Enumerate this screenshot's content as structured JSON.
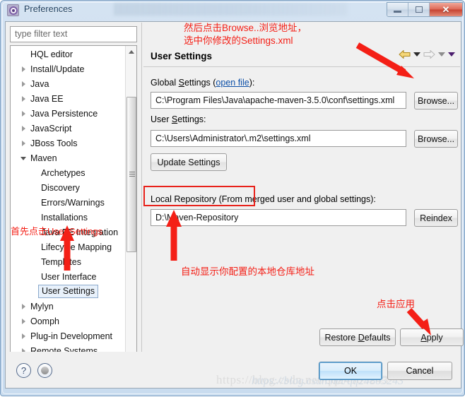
{
  "window": {
    "title": "Preferences",
    "icon": "gear-icon",
    "buttons": {
      "minimize": "Minimize",
      "maximize": "Maximize",
      "close": "Close"
    }
  },
  "sidebar": {
    "filter_placeholder": "type filter text",
    "items": [
      {
        "label": "HQL editor",
        "level": 1,
        "arrow": "none"
      },
      {
        "label": "Install/Update",
        "level": 1,
        "arrow": "collapsed"
      },
      {
        "label": "Java",
        "level": 1,
        "arrow": "collapsed"
      },
      {
        "label": "Java EE",
        "level": 1,
        "arrow": "collapsed"
      },
      {
        "label": "Java Persistence",
        "level": 1,
        "arrow": "collapsed"
      },
      {
        "label": "JavaScript",
        "level": 1,
        "arrow": "collapsed"
      },
      {
        "label": "JBoss Tools",
        "level": 1,
        "arrow": "collapsed"
      },
      {
        "label": "Maven",
        "level": 1,
        "arrow": "expanded"
      },
      {
        "label": "Archetypes",
        "level": 2,
        "arrow": "none"
      },
      {
        "label": "Discovery",
        "level": 2,
        "arrow": "none"
      },
      {
        "label": "Errors/Warnings",
        "level": 2,
        "arrow": "none"
      },
      {
        "label": "Installations",
        "level": 2,
        "arrow": "none"
      },
      {
        "label": "Java EE Integration",
        "level": 2,
        "arrow": "none"
      },
      {
        "label": "Lifecycle Mapping",
        "level": 2,
        "arrow": "none"
      },
      {
        "label": "Templates",
        "level": 2,
        "arrow": "none"
      },
      {
        "label": "User Interface",
        "level": 2,
        "arrow": "none"
      },
      {
        "label": "User Settings",
        "level": 2,
        "arrow": "none",
        "selected": true
      },
      {
        "label": "Mylyn",
        "level": 1,
        "arrow": "collapsed"
      },
      {
        "label": "Oomph",
        "level": 1,
        "arrow": "collapsed"
      },
      {
        "label": "Plug-in Development",
        "level": 1,
        "arrow": "collapsed"
      },
      {
        "label": "Remote Systems",
        "level": 1,
        "arrow": "collapsed"
      }
    ]
  },
  "main": {
    "page_title": "User Settings",
    "global_settings_label": "Global Settings (",
    "global_settings_link": "open file",
    "global_settings_label_end": "):",
    "global_settings_value": "C:\\Program Files\\Java\\apache-maven-3.5.0\\conf\\settings.xml",
    "global_browse_label": "Browse...",
    "user_settings_label": "User Settings:",
    "user_settings_value": "C:\\Users\\Administrator\\.m2\\settings.xml",
    "user_browse_label": "Browse...",
    "update_settings_label": "Update Settings",
    "local_repo_label": "Local Repository (From merged user and global settings):",
    "local_repo_value": "D:\\Maven-Repository",
    "reindex_label": "Reindex",
    "restore_defaults_label": "Restore Defaults",
    "apply_label": "Apply"
  },
  "annotations": {
    "browse_note_line1": "然后点击Browse..浏览地址，",
    "browse_note_line2": "选中你修改的Settings.xml",
    "tree_note": "首先点击User Settings",
    "repo_note": "自动显示你配置的本地仓库地址",
    "apply_note": "点击应用",
    "color": "#f41f16"
  },
  "footer": {
    "help_icon": "?",
    "ok_label": "OK",
    "cancel_label": "Cancel",
    "watermark": "https://blog.csdn.net/qq24805243",
    "watermark_overlay": "https://blog.csdn.net/qq24805243"
  }
}
